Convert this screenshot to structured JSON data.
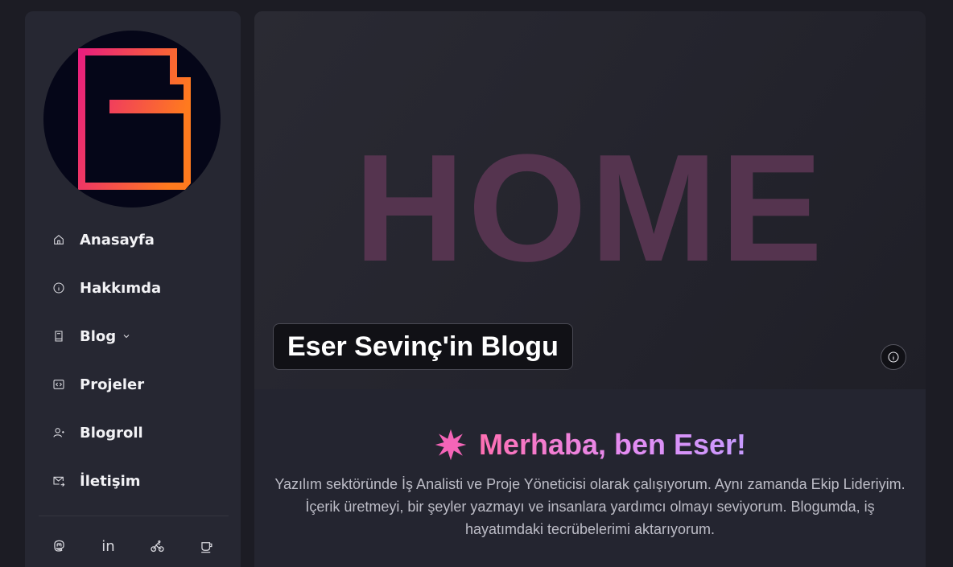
{
  "sidebar": {
    "logo": {
      "name": "logo-icon",
      "colors": [
        "#e81c80",
        "#ff7a1e"
      ]
    },
    "nav": [
      {
        "label": "Anasayfa",
        "icon": "home-icon"
      },
      {
        "label": "Hakkımda",
        "icon": "info-icon"
      },
      {
        "label": "Blog",
        "icon": "book-icon",
        "has_dropdown": true
      },
      {
        "label": "Projeler",
        "icon": "code-icon"
      },
      {
        "label": "Blogroll",
        "icon": "users-icon"
      },
      {
        "label": "İletişim",
        "icon": "mail-icon"
      }
    ],
    "social": [
      {
        "icon": "mastodon-icon"
      },
      {
        "icon": "linkedin-icon",
        "text": "in"
      },
      {
        "icon": "bike-icon"
      },
      {
        "icon": "coffee-icon"
      }
    ]
  },
  "hero": {
    "word": "HOME",
    "title": "Eser Sevinç'in Blogu",
    "word_color": "#55344f"
  },
  "intro": {
    "greeting": "Merhaba, ben Eser!",
    "bio": "Yazılım sektöründe İş Analisti ve Proje Yöneticisi olarak çalışıyorum. Aynı zamanda Ekip Lideriyim. İçerik üretmeyi, bir şeyler yazmayı ve insanlara yardımcı olmayı seviyorum. Blogumda, iş hayatımdaki tecrübelerimi aktarıyorum.",
    "accent": "#ff6fb2"
  }
}
